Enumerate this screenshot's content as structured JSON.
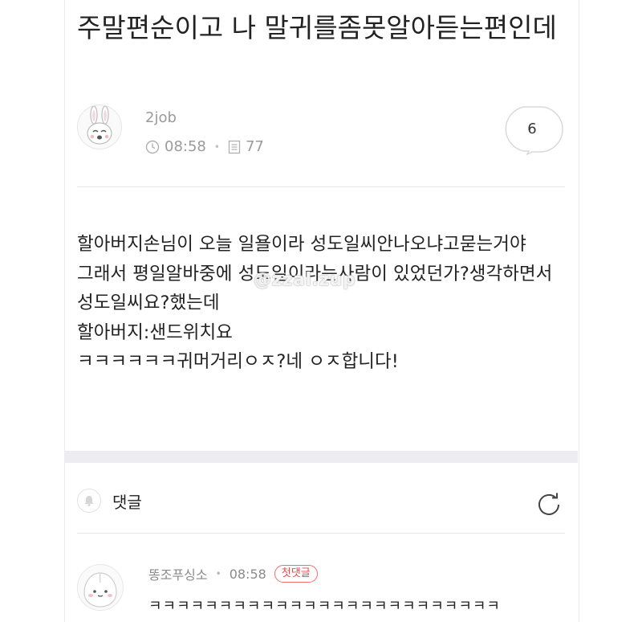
{
  "post": {
    "title": "주말편순이고 나 말귀를좀못알아듣는편인데",
    "author": "2job",
    "time": "08:58",
    "views": "77",
    "comment_count": "6",
    "body_lines": [
      "할아버지손님이 오늘 일욜이라 성도일씨안나오냐고묻는거야",
      "그래서 평일알바중에 성도일이라는사람이 있었던가?생각하면서 성도일씨요?했는데",
      "할아버지:샌드위치요",
      "ㅋㅋㅋㅋㅋㅋ귀머거리ㅇㅈ?네 ㅇㅈ합니다!"
    ]
  },
  "watermark": "@zzal.zup",
  "comments_section": {
    "label": "댓글"
  },
  "comments": [
    {
      "author": "똥조푸싱소",
      "time": "08:58",
      "badge": "첫댓글",
      "text": "ㅋㅋㅋㅋㅋㅋㅋㅋㅋㅋㅋㅋㅋㅋㅋㅋㅋㅋㅋㅋㅋㅋㅋㅋㅋ"
    }
  ],
  "icons": {
    "clock": "clock-icon",
    "views": "document-icon",
    "comment_bubble": "speech-bubble-icon",
    "bell": "bell-icon",
    "refresh": "refresh-icon"
  },
  "colors": {
    "meta_gray": "#9a9a9a",
    "badge_red": "#e84a4a",
    "band_gray": "#ececf1"
  }
}
